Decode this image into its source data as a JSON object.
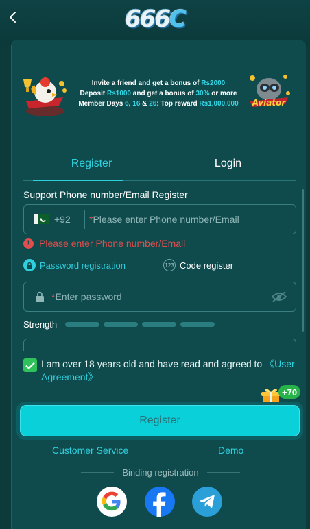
{
  "header": {
    "logo_text": "666",
    "logo_c": "C"
  },
  "banner": {
    "line1_prefix": "Invite a friend and get a bonus of ",
    "line1_amount": "Rs2000",
    "line2_prefix": "Deposit ",
    "line2_amount": "Rs1000",
    "line2_middle": " and get a bonus of ",
    "line2_percent": "30%",
    "line2_suffix": " or more",
    "line3_prefix": "Member Days ",
    "line3_d1": "6",
    "line3_sep1": ", ",
    "line3_d2": "16",
    "line3_sep2": " & ",
    "line3_d3": "26",
    "line3_middle": ": Top reward ",
    "line3_amount": "Rs1,000,000",
    "right_art_label": "Aviator"
  },
  "tabs": [
    {
      "label": "Register",
      "active": true
    },
    {
      "label": "Login",
      "active": false
    }
  ],
  "form": {
    "support_label": "Support Phone number/Email Register",
    "country_code": "+92",
    "required_mark": "*",
    "phone_placeholder": "Please enter Phone number/Email",
    "error_text": "Please enter Phone number/Email",
    "mode_password": "Password registration",
    "mode_code": "Code register",
    "code_icon_text": "123",
    "password_placeholder": "Enter password",
    "strength_label": "Strength",
    "strength_bars": 4,
    "agree_text": "I am over 18 years old and have read and agreed to ",
    "agree_link": "《User Agreement》",
    "agree_checked": true
  },
  "gift_badge": "+70",
  "register_button": "Register",
  "links": {
    "customer_service": "Customer Service",
    "demo": "Demo"
  },
  "binding_label": "Binding registration",
  "social_icons": [
    "google-icon",
    "facebook-icon",
    "telegram-icon"
  ],
  "colors": {
    "accent": "#2fd0de",
    "error": "#e24d4d",
    "button": "#0ad0da",
    "check": "#2fc25b",
    "panel": "#0f4a4c"
  }
}
